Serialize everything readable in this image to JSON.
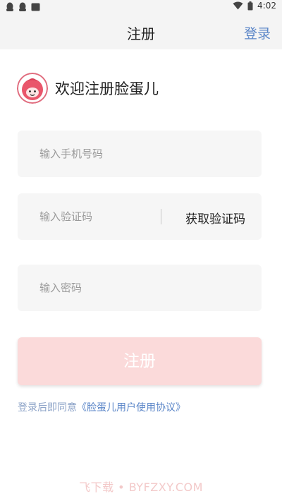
{
  "status_bar": {
    "time": "4:02",
    "left_icons": [
      "qq-icon",
      "qq-icon",
      "folder-icon"
    ],
    "right_icons": [
      "wifi-icon",
      "battery-icon"
    ]
  },
  "nav": {
    "title": "注册",
    "login_label": "登录"
  },
  "welcome": {
    "text": "欢迎注册脸蛋儿"
  },
  "form": {
    "phone_placeholder": "输入手机号码",
    "code_placeholder": "输入验证码",
    "get_code_label": "获取验证码",
    "password_placeholder": "输入密码"
  },
  "register_button": {
    "label": "注册"
  },
  "agreement": {
    "prefix": "登录后即同意",
    "link": "《脸蛋儿用户使用协议》"
  },
  "watermark": {
    "text": "飞下载 • BYFZXY.COM"
  },
  "colors": {
    "accent": "#5b86c8",
    "button_disabled": "#fbdada",
    "brand_pink": "#e9566b"
  }
}
